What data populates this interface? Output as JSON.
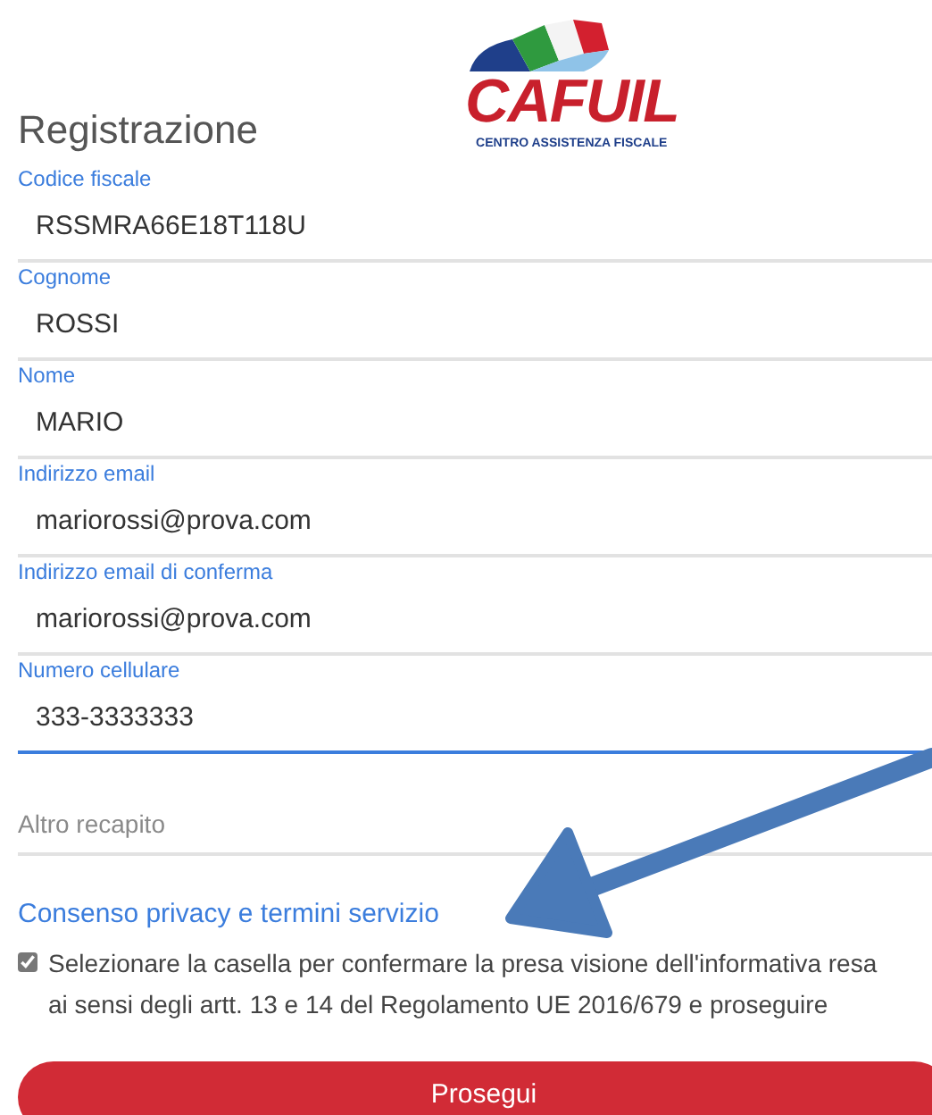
{
  "logo": {
    "name": "CAFUIL",
    "tagline": "CENTRO ASSISTENZA FISCALE"
  },
  "title": "Registrazione",
  "fields": [
    {
      "label": "Codice fiscale",
      "value": "RSSMRA66E18T118U",
      "focused": false
    },
    {
      "label": "Cognome",
      "value": "ROSSI",
      "focused": false
    },
    {
      "label": "Nome",
      "value": "MARIO",
      "focused": false
    },
    {
      "label": "Indirizzo email",
      "value": "mariorossi@prova.com",
      "focused": false
    },
    {
      "label": "Indirizzo email di conferma",
      "value": "mariorossi@prova.com",
      "focused": false
    },
    {
      "label": "Numero cellulare",
      "value": "333-3333333",
      "focused": true
    },
    {
      "placeholder": "Altro recapito",
      "focused": false
    }
  ],
  "consent": {
    "link": "Consenso privacy e termini servizio",
    "checked": true,
    "text": "Selezionare la casella per confermare la presa visione dell'informativa resa ai sensi degli artt. 13 e 14 del Regolamento UE 2016/679 e proseguire"
  },
  "button": "Prosegui"
}
